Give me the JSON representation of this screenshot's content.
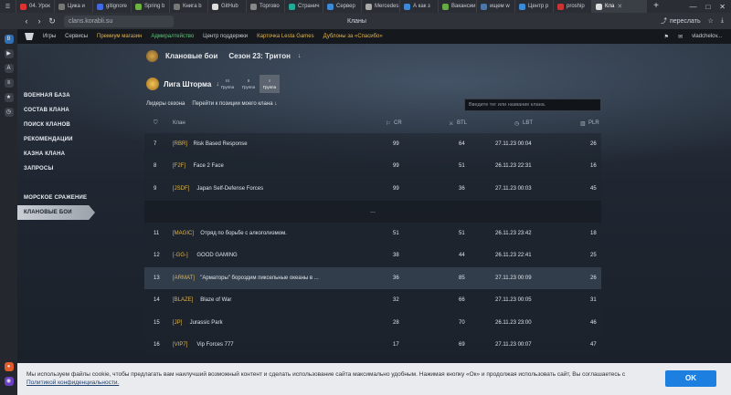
{
  "browser": {
    "tabs": [
      {
        "label": "04. Урок",
        "color": "#d33"
      },
      {
        "label": "Цика и",
        "color": "#777"
      },
      {
        "label": "gitignore",
        "color": "#4169e1"
      },
      {
        "label": "Spring b",
        "color": "#6db33f"
      },
      {
        "label": "Книга b",
        "color": "#777"
      },
      {
        "label": "GitHub",
        "color": "#ddd"
      },
      {
        "label": "Торгово",
        "color": "#888"
      },
      {
        "label": "Странич",
        "color": "#2a9"
      },
      {
        "label": "Сервер",
        "color": "#3a8ad8"
      },
      {
        "label": "Mercedes",
        "color": "#aaa"
      },
      {
        "label": "А как з",
        "color": "#3a8ad8"
      },
      {
        "label": "Вакансии",
        "color": "#6a4"
      },
      {
        "label": "ищем w",
        "color": "#4a76a8"
      },
      {
        "label": "Центр р",
        "color": "#3a8ad8"
      },
      {
        "label": "proship",
        "color": "#c33"
      },
      {
        "label": "Кла",
        "color": "#ddd",
        "active": true
      }
    ],
    "url": "clans.korabli.su",
    "page_title": "Кланы",
    "send_label": "переслать"
  },
  "wgnav": {
    "games": "Игры",
    "services": "Сервисы",
    "premium": "Премиум магазин",
    "admiralty": "Адмиралтейство",
    "support": "Центр поддержки",
    "lesta": "Карточка Lesta Games",
    "thanks": "Дублоны за «Спасибо»",
    "user": "vladchelov..."
  },
  "menu": {
    "items": [
      "ВОЕННАЯ БАЗА",
      "СОСТАВ КЛАНА",
      "ПОИСК КЛАНОВ",
      "РЕКОМЕНДАЦИИ",
      "КАЗНА КЛАНА",
      "ЗАПРОСЫ"
    ],
    "items2": [
      "МОРСКОЕ СРАЖЕНИЕ",
      "КЛАНОВЫЕ БОИ"
    ]
  },
  "header": {
    "title": "Клановые бои",
    "season": "Сезон 23: Тритон",
    "league": "Лига Шторма",
    "groups": [
      {
        "num": "III",
        "label": "Группа"
      },
      {
        "num": "II",
        "label": "Группа"
      },
      {
        "num": "I",
        "label": "Группа"
      }
    ],
    "leaders": "Лидеры сезона",
    "goto": "Перейти к позиции моего клана",
    "search_placeholder": "Введите тег или название клана."
  },
  "table": {
    "headers": {
      "clan": "Клан",
      "cr": "CR",
      "btl": "BTL",
      "lbt": "LBT",
      "plr": "PLR"
    },
    "rows": [
      {
        "pos": "7",
        "tag": "[RBR]",
        "name": "Risk Based Response",
        "cr": "99",
        "btl": "64",
        "lbt": "27.11.23 00:04",
        "plr": "26"
      },
      {
        "pos": "8",
        "tag": "[F2F]",
        "name": "Face 2 Face",
        "cr": "99",
        "btl": "51",
        "lbt": "26.11.23 22:31",
        "plr": "16"
      },
      {
        "pos": "9",
        "tag": "[JSDF]",
        "name": "Japan Self-Defense Forces",
        "cr": "99",
        "btl": "36",
        "lbt": "27.11.23 00:03",
        "plr": "45"
      },
      {
        "pos": "11",
        "tag": "[MAGIC]",
        "name": "Отряд по борьбе с алкоголизмом.",
        "cr": "51",
        "btl": "51",
        "lbt": "26.11.23 23:42",
        "plr": "18"
      },
      {
        "pos": "12",
        "tag": "[-GG-]",
        "name": "GOOD GAMING",
        "cr": "38",
        "btl": "44",
        "lbt": "26.11.23 22:41",
        "plr": "25"
      },
      {
        "pos": "13",
        "tag": "[ARMAT]",
        "name": "\"Арматоры\" бороздим пиксельные океаны в ...",
        "cr": "36",
        "btl": "85",
        "lbt": "27.11.23 00:09",
        "plr": "26"
      },
      {
        "pos": "14",
        "tag": "[BLAZE]",
        "name": "Blaze of War",
        "cr": "32",
        "btl": "66",
        "lbt": "27.11.23 00:05",
        "plr": "31"
      },
      {
        "pos": "15",
        "tag": "[JP]",
        "name": "Jurassic Park",
        "cr": "28",
        "btl": "70",
        "lbt": "26.11.23 23:00",
        "plr": "46"
      },
      {
        "pos": "16",
        "tag": "[VIP7]",
        "name": "Vip Forces 777",
        "cr": "17",
        "btl": "69",
        "lbt": "27.11.23 00:07",
        "plr": "47"
      }
    ],
    "ellipsis": "..."
  },
  "cookie": {
    "text": "Мы используем файлы cookie, чтобы предлагать вам наилучший возможный контент и сделать использование сайта максимально удобным. Нажимая кнопку «Ок» и продолжая использовать сайт, Вы соглашаетесь с",
    "link": "Политикой конфиденциальности.",
    "ok": "OK"
  }
}
